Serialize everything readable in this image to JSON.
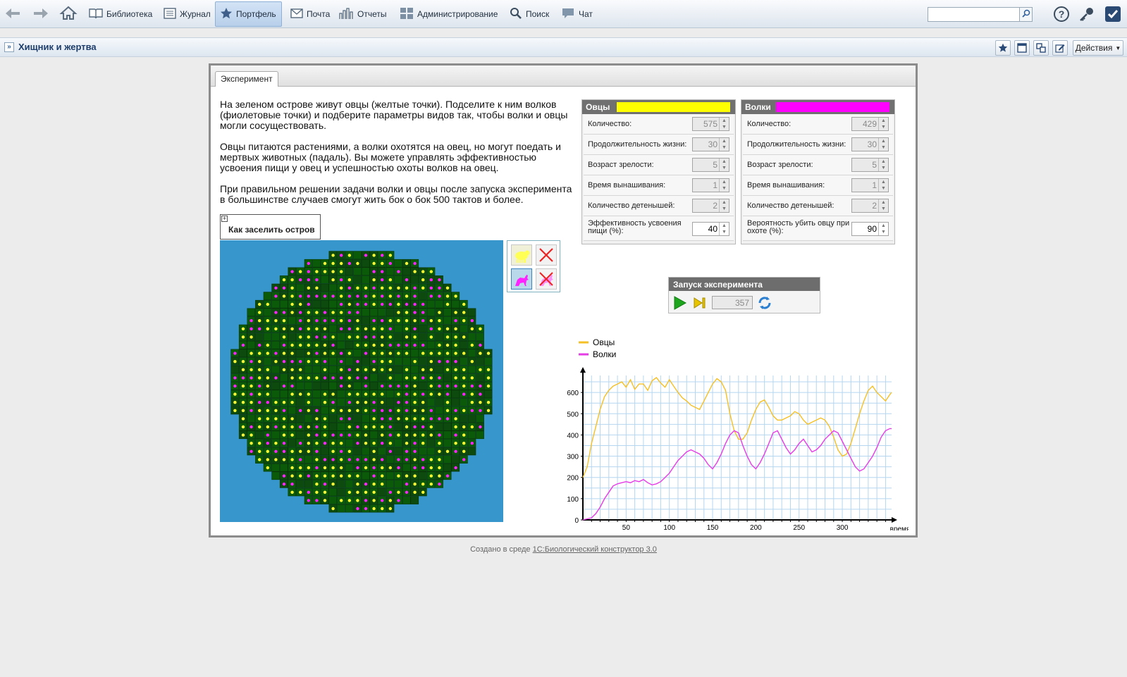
{
  "toolbar": {
    "menu": [
      {
        "label": "Библиотека",
        "icon": "book-icon"
      },
      {
        "label": "Журнал",
        "icon": "journal-icon"
      },
      {
        "label": "Портфель",
        "icon": "star-icon",
        "active": true
      },
      {
        "label": "Почта",
        "icon": "mail-icon"
      },
      {
        "label": "Отчеты",
        "icon": "reports-icon"
      },
      {
        "label": "Администрирование",
        "icon": "admin-icon"
      },
      {
        "label": "Поиск",
        "icon": "search-icon"
      },
      {
        "label": "Чат",
        "icon": "chat-icon"
      }
    ],
    "search": {
      "value": "",
      "placeholder": ""
    }
  },
  "subbar": {
    "title": "Хищник и жертва",
    "actions_label": "Действия"
  },
  "experiment": {
    "tab_label": "Эксперимент",
    "description": [
      "На зеленом острове живут овцы (желтые точки). Подселите к ним волков (фиолетовые точки) и подберите параметры видов так, чтобы волки и овцы могли сосуществовать.",
      "Овцы питаются растениями, а волки охотятся на овец, но могут поедать и мертвых животных (падаль). Вы можете управлять эффективностью усвоения пищи у овец и успешностью охоты волков на овец.",
      "При правильном решении задачи волки и овцы после запуска эксперимента в большинстве случаев  смогут жить бок о бок 500 тактов и более."
    ],
    "howto_label": "Как заселить остров",
    "sheep": {
      "title": "Овцы",
      "color": "#ffff00",
      "params": [
        {
          "label": "Количество:",
          "value": "575"
        },
        {
          "label": "Продолжительность жизни:",
          "value": "30"
        },
        {
          "label": "Возраст зрелости:",
          "value": "5"
        },
        {
          "label": "Время вынашивания:",
          "value": "1"
        },
        {
          "label": "Количество детенышей:",
          "value": "2"
        },
        {
          "label": "Эффективность усвоения пищи (%):",
          "value": "40"
        }
      ]
    },
    "wolves": {
      "title": "Волки",
      "color": "#ff00ff",
      "params": [
        {
          "label": "Количество:",
          "value": "429"
        },
        {
          "label": "Продолжительность жизни:",
          "value": "30"
        },
        {
          "label": "Возраст зрелости:",
          "value": "5"
        },
        {
          "label": "Время вынашивания:",
          "value": "1"
        },
        {
          "label": "Количество детенышей:",
          "value": "2"
        },
        {
          "label": "Вероятность убить овцу при охоте (%):",
          "value": "90"
        }
      ]
    },
    "launch": {
      "title": "Запуск эксперимента",
      "counter": "357"
    }
  },
  "chart_data": {
    "type": "line",
    "xlabel": "время",
    "ylabel": "",
    "xlim": [
      0,
      357
    ],
    "ylim": [
      0,
      680
    ],
    "xticks": [
      50,
      100,
      150,
      200,
      250,
      300
    ],
    "yticks": [
      0,
      100,
      200,
      300,
      400,
      500,
      600
    ],
    "grid": true,
    "legend_position": "top-left",
    "series": [
      {
        "name": "Овцы",
        "color": "#f5c026",
        "x": [
          0,
          5,
          10,
          15,
          20,
          25,
          30,
          35,
          40,
          45,
          50,
          55,
          60,
          65,
          70,
          75,
          80,
          85,
          90,
          95,
          100,
          105,
          110,
          115,
          120,
          125,
          130,
          135,
          140,
          145,
          150,
          155,
          160,
          165,
          170,
          175,
          180,
          185,
          190,
          195,
          200,
          205,
          210,
          215,
          220,
          225,
          230,
          235,
          240,
          245,
          250,
          255,
          260,
          265,
          270,
          275,
          280,
          285,
          290,
          295,
          300,
          305,
          310,
          315,
          320,
          325,
          330,
          335,
          340,
          345,
          350,
          355,
          357
        ],
        "values": [
          200,
          250,
          360,
          440,
          520,
          580,
          610,
          630,
          640,
          650,
          625,
          660,
          615,
          640,
          640,
          610,
          655,
          670,
          645,
          625,
          660,
          630,
          600,
          575,
          560,
          540,
          530,
          520,
          560,
          600,
          640,
          665,
          650,
          610,
          500,
          420,
          380,
          380,
          410,
          470,
          520,
          555,
          565,
          530,
          490,
          470,
          470,
          480,
          490,
          510,
          500,
          470,
          450,
          460,
          470,
          480,
          470,
          440,
          390,
          330,
          300,
          310,
          360,
          430,
          500,
          560,
          610,
          630,
          600,
          580,
          560,
          590,
          600
        ]
      },
      {
        "name": "Волки",
        "color": "#e63ce6",
        "x": [
          0,
          5,
          10,
          15,
          20,
          25,
          30,
          35,
          40,
          45,
          50,
          55,
          60,
          65,
          70,
          75,
          80,
          85,
          90,
          95,
          100,
          105,
          110,
          115,
          120,
          125,
          130,
          135,
          140,
          145,
          150,
          155,
          160,
          165,
          170,
          175,
          180,
          185,
          190,
          195,
          200,
          205,
          210,
          215,
          220,
          225,
          230,
          235,
          240,
          245,
          250,
          255,
          260,
          265,
          270,
          275,
          280,
          285,
          290,
          295,
          300,
          305,
          310,
          315,
          320,
          325,
          330,
          335,
          340,
          345,
          350,
          355,
          357
        ],
        "values": [
          0,
          5,
          10,
          30,
          60,
          100,
          130,
          160,
          170,
          175,
          180,
          175,
          185,
          180,
          190,
          175,
          165,
          170,
          180,
          200,
          220,
          250,
          280,
          300,
          320,
          330,
          320,
          310,
          290,
          260,
          240,
          270,
          310,
          360,
          400,
          420,
          410,
          350,
          300,
          260,
          240,
          270,
          310,
          360,
          410,
          420,
          380,
          340,
          310,
          330,
          360,
          380,
          350,
          320,
          330,
          350,
          380,
          400,
          420,
          410,
          370,
          330,
          290,
          250,
          230,
          240,
          270,
          300,
          340,
          390,
          420,
          430,
          430
        ]
      }
    ]
  },
  "footer": {
    "prefix": "Создано в среде",
    "link": "1С:Биологический конструктор 3.0"
  }
}
